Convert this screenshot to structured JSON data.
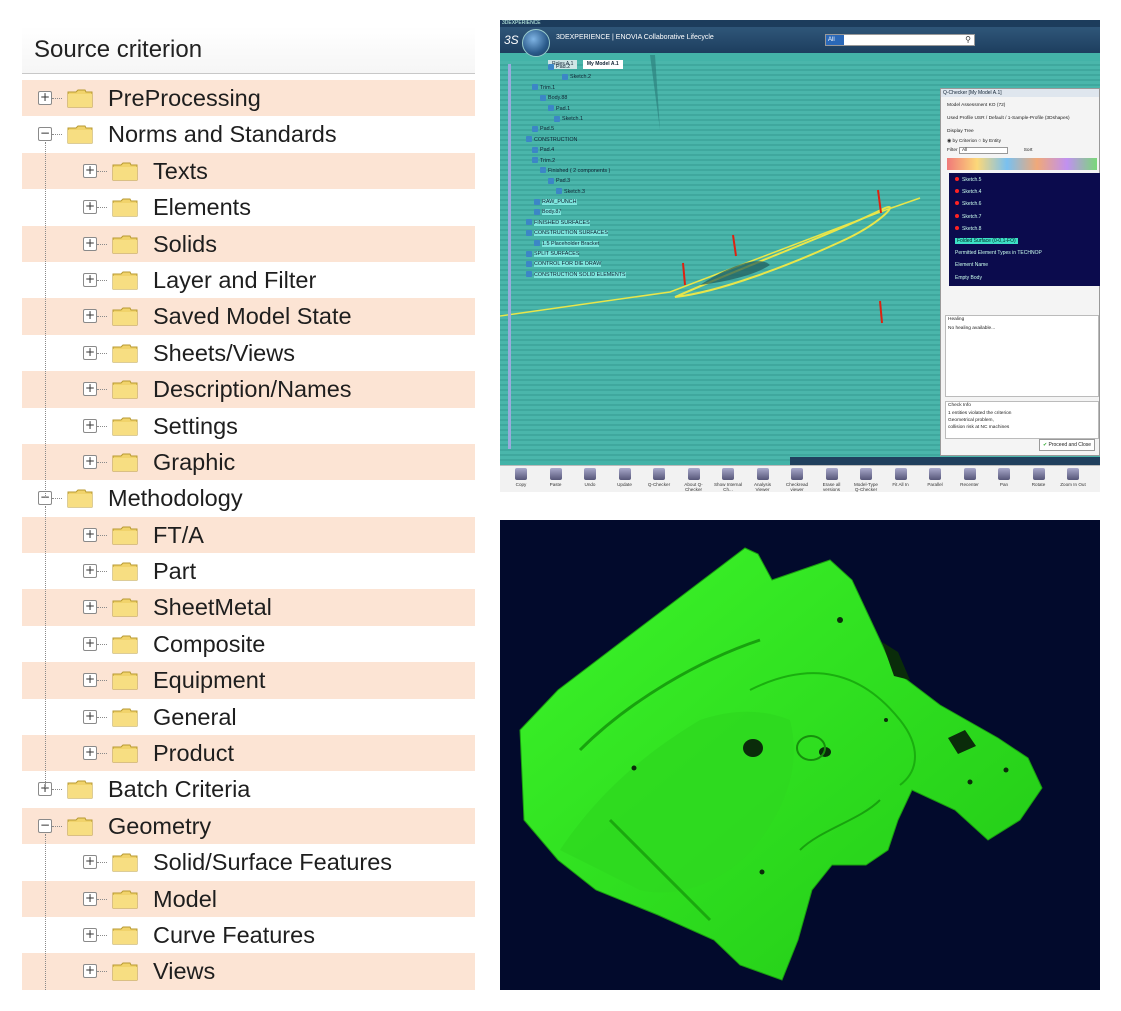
{
  "tree": {
    "header": "Source criterion",
    "rows": [
      {
        "label": "PreProcessing",
        "level": 0,
        "expanded": false
      },
      {
        "label": "Norms and Standards",
        "level": 0,
        "expanded": true
      },
      {
        "label": "Texts",
        "level": 1,
        "expanded": false
      },
      {
        "label": "Elements",
        "level": 1,
        "expanded": false
      },
      {
        "label": "Solids",
        "level": 1,
        "expanded": false
      },
      {
        "label": "Layer and Filter",
        "level": 1,
        "expanded": false
      },
      {
        "label": "Saved Model State",
        "level": 1,
        "expanded": false
      },
      {
        "label": "Sheets/Views",
        "level": 1,
        "expanded": false
      },
      {
        "label": "Description/Names",
        "level": 1,
        "expanded": false
      },
      {
        "label": "Settings",
        "level": 1,
        "expanded": false
      },
      {
        "label": "Graphic",
        "level": 1,
        "expanded": false
      },
      {
        "label": "Methodology",
        "level": 0,
        "expanded": true
      },
      {
        "label": "FT/A",
        "level": 1,
        "expanded": false
      },
      {
        "label": "Part",
        "level": 1,
        "expanded": false
      },
      {
        "label": "SheetMetal",
        "level": 1,
        "expanded": false
      },
      {
        "label": "Composite",
        "level": 1,
        "expanded": false
      },
      {
        "label": "Equipment",
        "level": 1,
        "expanded": false
      },
      {
        "label": "General",
        "level": 1,
        "expanded": false
      },
      {
        "label": "Product",
        "level": 1,
        "expanded": false
      },
      {
        "label": "Batch Criteria",
        "level": 0,
        "expanded": false
      },
      {
        "label": "Geometry",
        "level": 0,
        "expanded": true
      },
      {
        "label": "Solid/Surface Features",
        "level": 1,
        "expanded": false
      },
      {
        "label": "Model",
        "level": 1,
        "expanded": false
      },
      {
        "label": "Curve Features",
        "level": 1,
        "expanded": false
      },
      {
        "label": "Views",
        "level": 1,
        "expanded": false
      }
    ]
  },
  "app": {
    "topbar": "3DEXPERIENCE",
    "brand": "3DEXPERIENCE | ENOVIA Collaborative Lifecycle",
    "search_scope": "All",
    "tabs": [
      "Roles A.1",
      "My Model A.1"
    ],
    "spec_tree": [
      {
        "label": "Pad.2"
      },
      {
        "label": "Sketch.2"
      },
      {
        "label": "Trim.1"
      },
      {
        "label": "Body.88"
      },
      {
        "label": "Pad.1"
      },
      {
        "label": "Sketch.1"
      },
      {
        "label": "Pad.5"
      },
      {
        "label": "CONSTRUCTION"
      },
      {
        "label": "Pad.4"
      },
      {
        "label": "Trim.2"
      },
      {
        "label": "Finished ( 2 components )"
      },
      {
        "label": "Pad.3"
      },
      {
        "label": "Sketch.3"
      },
      {
        "label": "RAW_PUNCH"
      },
      {
        "label": "Body.87"
      },
      {
        "label": "FINISHED SURFACES"
      },
      {
        "label": "CONSTRUCTION SURFACES"
      },
      {
        "label": "1.5 Placeholder Bracket"
      },
      {
        "label": "SPLIT SURFACES"
      },
      {
        "label": "CONTROL FOR DIE DRAW"
      },
      {
        "label": "CONSTRUCTION SOLID ELEMENTS"
      }
    ],
    "qchecker": {
      "title": "Q-Checker [My Model A.1]",
      "assessment": "Model Assessment KO (72)",
      "profile": "Used Profile USR / Default / 1-Sample-Profile (3Dshapes)",
      "display_tree": "Display Tree",
      "by_criterion": "by Criterion",
      "by_entity": "by Entity",
      "filter_label": "Filter",
      "filter_value": "All",
      "sort_label": "Sort",
      "tree_items": [
        "Sketch.5",
        "Sketch.4",
        "Sketch.6",
        "Sketch.7",
        "Sketch.8",
        "Folded Surface (0-0,1-FO)",
        "Permitted Element Types in TECHNOP",
        "Element Name",
        "Empty Body"
      ],
      "healing_label": "Healing",
      "healing_text": "No healing available...",
      "check_info_label": "Check Info",
      "check_info_text": [
        "1 entities violated the criterion",
        "Geometrical problem,",
        "collision risk at NC machines"
      ],
      "proceed": "Proceed and Close"
    },
    "bottom_tabs": [
      "Lifecycle",
      "Collaboration",
      "Q-Checker",
      "View",
      "Tools",
      "Touch"
    ],
    "active_bottom_tab": "Q-Checker",
    "toolbar": [
      "Copy",
      "Paste",
      "Undo",
      "Update",
      "Q-Checker",
      "About Q-Checker",
      "Show Internal Ch...",
      "Analysis Viewer",
      "Checkread viewer",
      "Erase all versions",
      "Model-Type Q-Checker",
      "Fit All In",
      "Parallel",
      "Recenter",
      "Pan",
      "Rotate",
      "Zoom In Out"
    ]
  },
  "colors": {
    "band": "#fce4d4",
    "part_green": "#33ee22",
    "render_bg": "#020a2c",
    "teal": "#44b3a8"
  }
}
